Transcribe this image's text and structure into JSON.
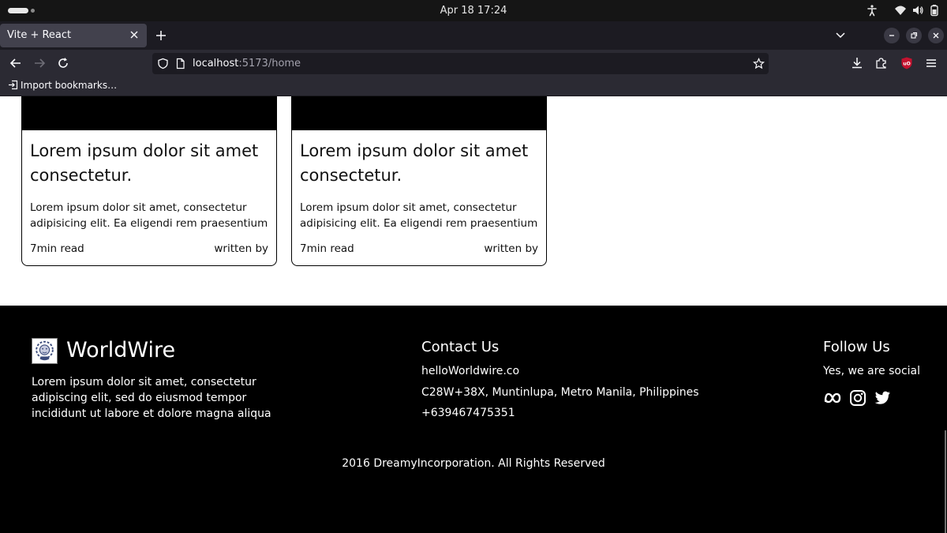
{
  "os": {
    "clock": "Apr 18  17:24"
  },
  "browser": {
    "tab_title": "Vite + React",
    "url_host": "localhost",
    "url_rest": ":5173/home",
    "bookmark_item": "Import bookmarks…"
  },
  "cards": [
    {
      "title": "Lorem ipsum dolor sit amet consectetur.",
      "description": "Lorem ipsum dolor sit amet, consectetur adipisicing elit. Ea eligendi rem praesentium",
      "read_time": "7min read",
      "author_label": "written by"
    },
    {
      "title": "Lorem ipsum dolor sit amet consectetur.",
      "description": "Lorem ipsum dolor sit amet, consectetur adipisicing elit. Ea eligendi rem praesentium",
      "read_time": "7min read",
      "author_label": "written by"
    }
  ],
  "footer": {
    "brand": "WorldWire",
    "brand_description": "Lorem ipsum dolor sit amet, consectetur adipiscing elit, sed do eiusmod tempor incididunt ut labore et dolore magna aliqua",
    "contact_heading": "Contact Us",
    "email": "helloWorldwire.co",
    "address": "C28W+38X, Muntinlupa, Metro Manila, Philippines",
    "phone": "+639467475351",
    "follow_heading": "Follow Us",
    "follow_text": "Yes, we are social",
    "social_icons": [
      "meta-icon",
      "instagram-icon",
      "twitter-icon"
    ],
    "copyright": "2016 DreamyIncorporation. All Rights Reserved"
  },
  "colors": {
    "page_bg": "#ffffff",
    "footer_bg": "#000000",
    "browser_chrome": "#2b2a33",
    "ublock_red": "#c4122f"
  }
}
